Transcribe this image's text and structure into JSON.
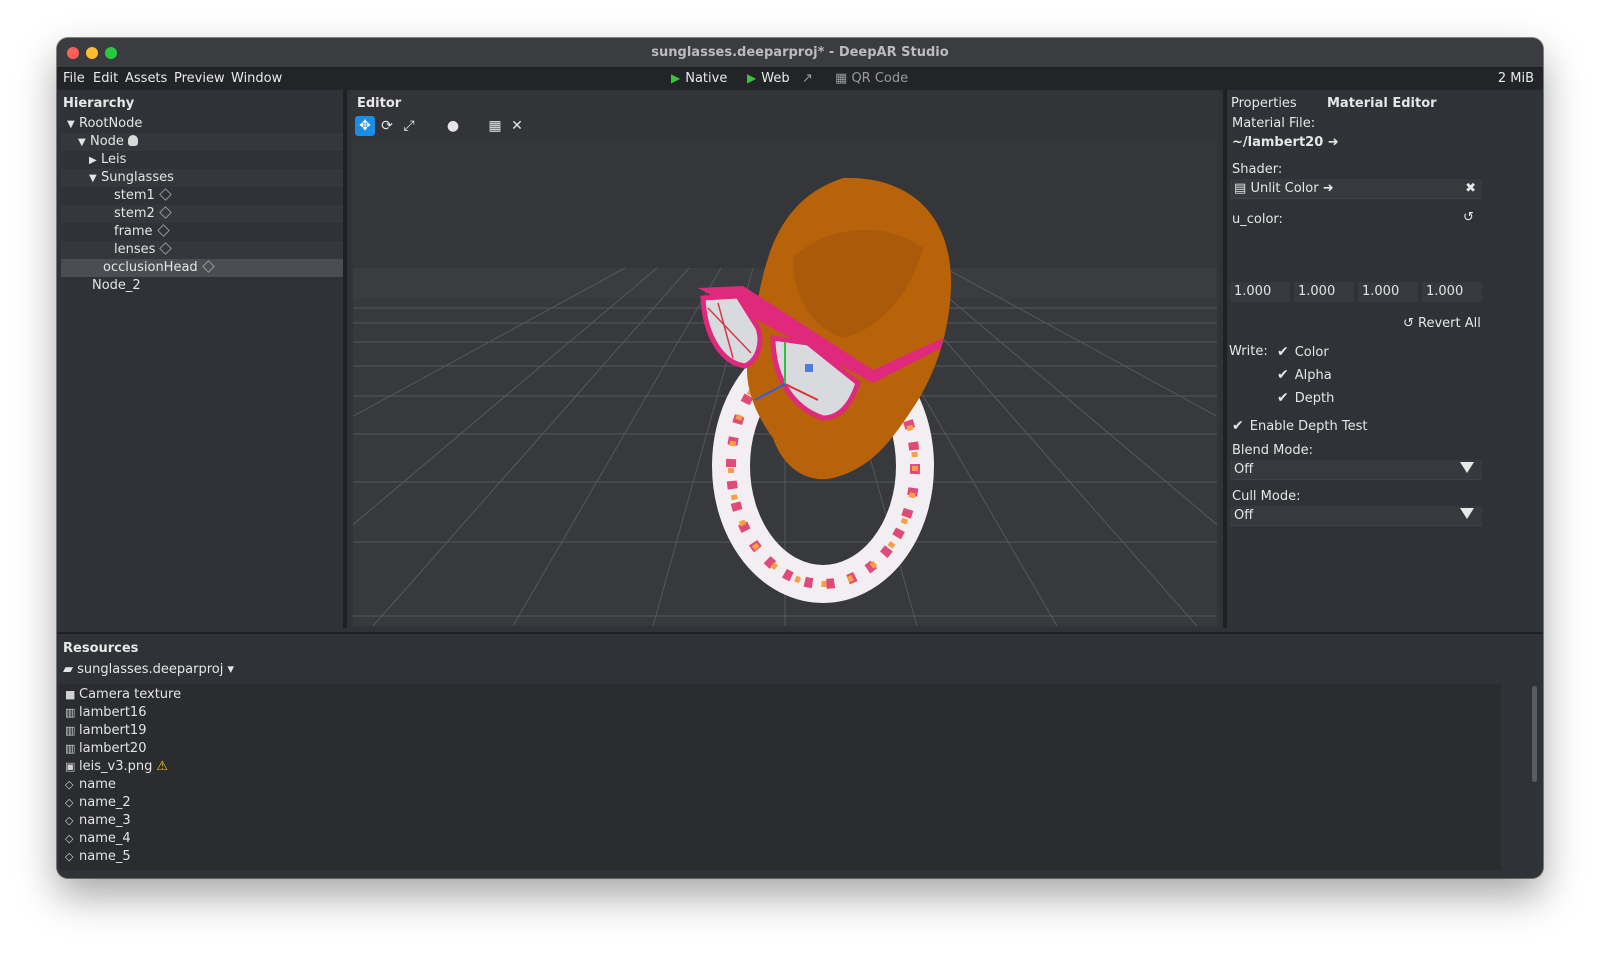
{
  "window": {
    "title": "sunglasses.deeparproj* - DeepAR Studio"
  },
  "menu": {
    "items": [
      "File",
      "Edit",
      "Assets",
      "Preview",
      "Window"
    ],
    "native_label": "Native",
    "web_label": "Web",
    "qr_label": "QR Code",
    "memory": "2 MiB"
  },
  "hierarchy": {
    "title": "Hierarchy",
    "items": [
      {
        "label": "RootNode"
      },
      {
        "label": "Node"
      },
      {
        "label": "Leis"
      },
      {
        "label": "Sunglasses"
      },
      {
        "label": "stem1"
      },
      {
        "label": "stem2"
      },
      {
        "label": "frame"
      },
      {
        "label": "lenses"
      },
      {
        "label": "occlusionHead"
      },
      {
        "label": "Node_2"
      }
    ]
  },
  "editor": {
    "title": "Editor"
  },
  "properties": {
    "tab_properties": "Properties",
    "tab_material": "Material Editor",
    "material_file_label": "Material File:",
    "material_file_value": "~/lambert20",
    "shader_label": "Shader:",
    "shader_value": "Unlit Color",
    "u_color_label": "u_color:",
    "u_color_values": [
      "1.000",
      "1.000",
      "1.000",
      "1.000"
    ],
    "revert_all": "Revert All",
    "write_label": "Write:",
    "write_color": "Color",
    "write_alpha": "Alpha",
    "write_depth": "Depth",
    "enable_depth_test": "Enable Depth Test",
    "blend_mode_label": "Blend Mode:",
    "blend_mode_value": "Off",
    "cull_mode_label": "Cull Mode:",
    "cull_mode_value": "Off"
  },
  "resources": {
    "title": "Resources",
    "project": "sunglasses.deeparproj",
    "items": [
      {
        "label": "Camera texture",
        "icon": "camera-icon"
      },
      {
        "label": "lambert16",
        "icon": "material-icon"
      },
      {
        "label": "lambert19",
        "icon": "material-icon"
      },
      {
        "label": "lambert20",
        "icon": "material-icon"
      },
      {
        "label": "leis_v3.png",
        "icon": "image-icon"
      },
      {
        "label": "name",
        "icon": "mesh-icon"
      },
      {
        "label": "name_2",
        "icon": "mesh-icon"
      },
      {
        "label": "name_3",
        "icon": "mesh-icon"
      },
      {
        "label": "name_4",
        "icon": "mesh-icon"
      },
      {
        "label": "name_5",
        "icon": "mesh-icon"
      }
    ]
  },
  "colors": {
    "accent": "#1a8de8",
    "play": "#39c339",
    "warning": "#f2c331",
    "head": "#b8620a",
    "frame": "#e0287c"
  }
}
